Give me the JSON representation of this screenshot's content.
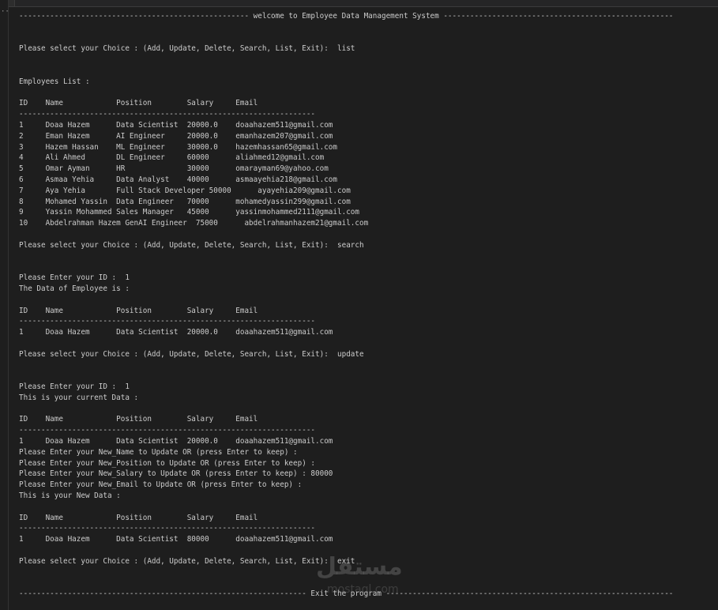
{
  "gutter": {
    "dots_glyph": "··"
  },
  "terminal": {
    "lines": [
      "---------------------------------------------------- welcome to Employee Data Management System ----------------------------------------------------",
      "",
      "",
      "Please select your Choice : (Add, Update, Delete, Search, List, Exit):  list",
      "",
      "",
      "Employees List :",
      "",
      "ID    Name            Position        Salary     Email",
      "-------------------------------------------------------------------",
      "1     Doaa Hazem      Data Scientist  20000.0    doaahazem511@gmail.com",
      "2     Eman Hazem      AI Engineer     20000.0    emanhazem207@gmail.com",
      "3     Hazem Hassan    ML Engineer     30000.0    hazemhassan65@gmail.com",
      "4     Ali Ahmed       DL Engineer     60000      aliahmed12@gmail.com",
      "5     Omar Ayman      HR              30000      omarayman69@yahoo.com",
      "6     Asmaa Yehia     Data Analyst    40000      asmaayehia218@gmail.com",
      "7     Aya Yehia       Full Stack Developer 50000      ayayehia209@gmail.com",
      "8     Mohamed Yassin  Data Engineer   70000      mohamedyassin299@gmail.com",
      "9     Yassin Mohammed Sales Manager   45000      yassinmohammed2111@gmail.com",
      "10    Abdelrahman Hazem GenAI Engineer  75000      abdelrahmanhazem21@gmail.com",
      "",
      "Please select your Choice : (Add, Update, Delete, Search, List, Exit):  search",
      "",
      "",
      "Please Enter your ID :  1",
      "The Data of Employee is :",
      "",
      "ID    Name            Position        Salary     Email",
      "-------------------------------------------------------------------",
      "1     Doaa Hazem      Data Scientist  20000.0    doaahazem511@gmail.com",
      "",
      "Please select your Choice : (Add, Update, Delete, Search, List, Exit):  update",
      "",
      "",
      "Please Enter your ID :  1",
      "This is your current Data :",
      "",
      "ID    Name            Position        Salary     Email",
      "-------------------------------------------------------------------",
      "1     Doaa Hazem      Data Scientist  20000.0    doaahazem511@gmail.com",
      "Please Enter your New_Name to Update OR (press Enter to keep) :",
      "Please Enter your New_Position to Update OR (press Enter to keep) :",
      "Please Enter your New_Salary to Update OR (press Enter to keep) : 80000",
      "Please Enter your New_Email to Update OR (press Enter to keep) :",
      "This is your New Data :",
      "",
      "ID    Name            Position        Salary     Email",
      "-------------------------------------------------------------------",
      "1     Doaa Hazem      Data Scientist  80000      doaahazem511@gmail.com",
      "",
      "Please select your Choice : (Add, Update, Delete, Search, List, Exit):  exit",
      "",
      "",
      "----------------------------------------------------------------- Exit the program -----------------------------------------------------------------"
    ]
  },
  "watermark": {
    "text": "مستقل",
    "subtext": "mostaql.com"
  }
}
